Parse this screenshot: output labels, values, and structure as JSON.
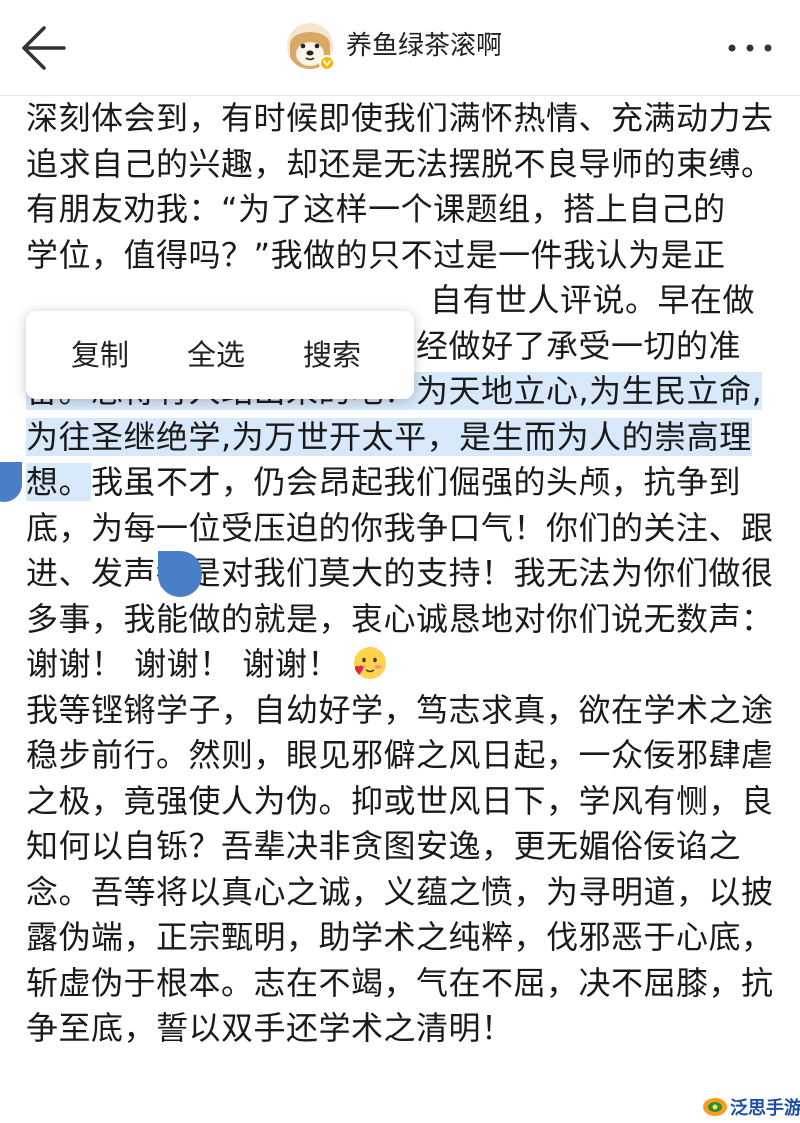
{
  "header": {
    "title": "养鱼绿茶滚啊"
  },
  "article": {
    "p1": "深刻体会到，有时候即使我们满怀热情、充满动力去追求自己的兴趣，却还是无法摆脱不良导师的束缚。",
    "p2_line1": "有朋友劝我：“为了这样一个课题组，搭上自己的",
    "p2_line2": "学位，值得吗？”我做的只不过是一件我认为是正",
    "p2_line3_visible": "自有世人评说。早在做",
    "p2_line4": "出这个决定之时，我们就已经做好了承受一切的准",
    "p2_sel": "备。总得有人站出来的吧！为天地立心,为生民立命,为往圣继绝学,为万世开太平，是生而为人的崇高理想。",
    "p2_rest": "我虽不才，仍会昂起我们倔强的头颅，抗争到底，为每一位受压迫的你我争口气！你们的关注、跟进、发声都是对我们莫大的支持！我无法为你们做很多事，我能做的就是，衷心诚恳地对你们说无数声：谢谢！  谢谢！  谢谢！",
    "p3": "我等铿锵学子，自幼好学，笃志求真，欲在学术之途稳步前行。然则，眼见邪僻之风日起，一众佞邪肆虐之极，竟强使人为伪。抑或世风日下，学风有恻，良知何以自铄？吾辈决非贪图安逸，更无媚俗佞谄之念。吾等将以真心之诚，义蕴之愤，为寻明道，以披露伪端，正宗甄明，助学术之纯粹，伐邪恶于心底，斩虚伪于根本。志在不竭，气在不屈，决不屈膝，抗争至底，誓以双手还学术之清明！"
  },
  "popup": {
    "copy": "复制",
    "select_all": "全选",
    "search": "搜索"
  },
  "watermark": {
    "text": "泛思手游网"
  },
  "colors": {
    "selection": "#d7e8fb",
    "handle": "#4a7ec6"
  }
}
